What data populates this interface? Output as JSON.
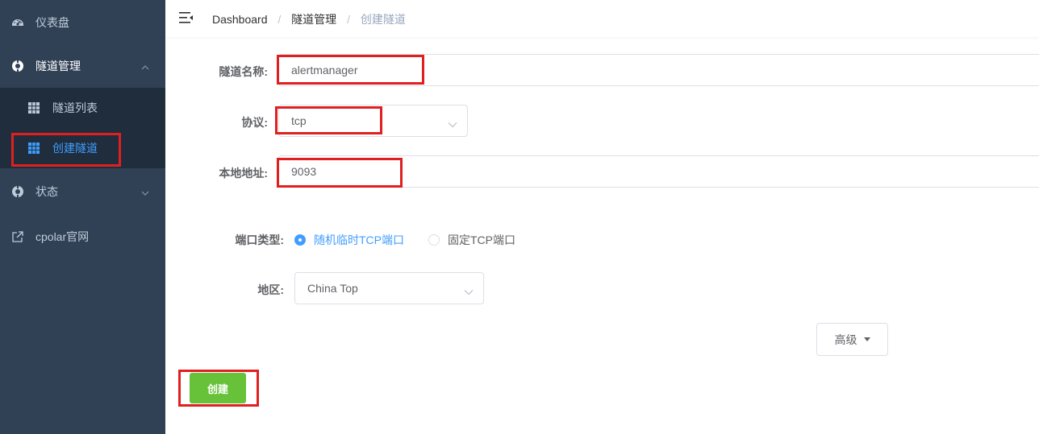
{
  "sidebar": {
    "dashboard": {
      "label": "仪表盘",
      "icon": "dashboard-gauge-icon"
    },
    "tunnel_mgmt": {
      "label": "隧道管理",
      "icon": "tunnel-circle-icon"
    },
    "tunnel_list": {
      "label": "隧道列表",
      "icon": "grid-icon"
    },
    "create_tunnel": {
      "label": "创建隧道",
      "icon": "grid-icon"
    },
    "status": {
      "label": "状态",
      "icon": "status-circle-icon"
    },
    "cpolar_site": {
      "label": "cpolar官网",
      "icon": "external-link-icon"
    }
  },
  "breadcrumb": {
    "home": "Dashboard",
    "section": "隧道管理",
    "current": "创建隧道",
    "separator": "/"
  },
  "form": {
    "name_label": "隧道名称:",
    "name_value": "alertmanager",
    "protocol_label": "协议:",
    "protocol_value": "tcp",
    "local_addr_label": "本地地址:",
    "local_addr_value": "9093",
    "port_type_label": "端口类型:",
    "port_type_options": [
      "随机临时TCP端口",
      "固定TCP端口"
    ],
    "port_type_selected": "随机临时TCP端口",
    "region_label": "地区:",
    "region_value": "China Top",
    "advanced_label": "高级",
    "create_label": "创建"
  },
  "colors": {
    "sidebar_bg": "#304156",
    "submenu_bg": "#1f2d3d",
    "active": "#409eff",
    "create_button": "#67c23a",
    "highlight": "#e02020"
  }
}
